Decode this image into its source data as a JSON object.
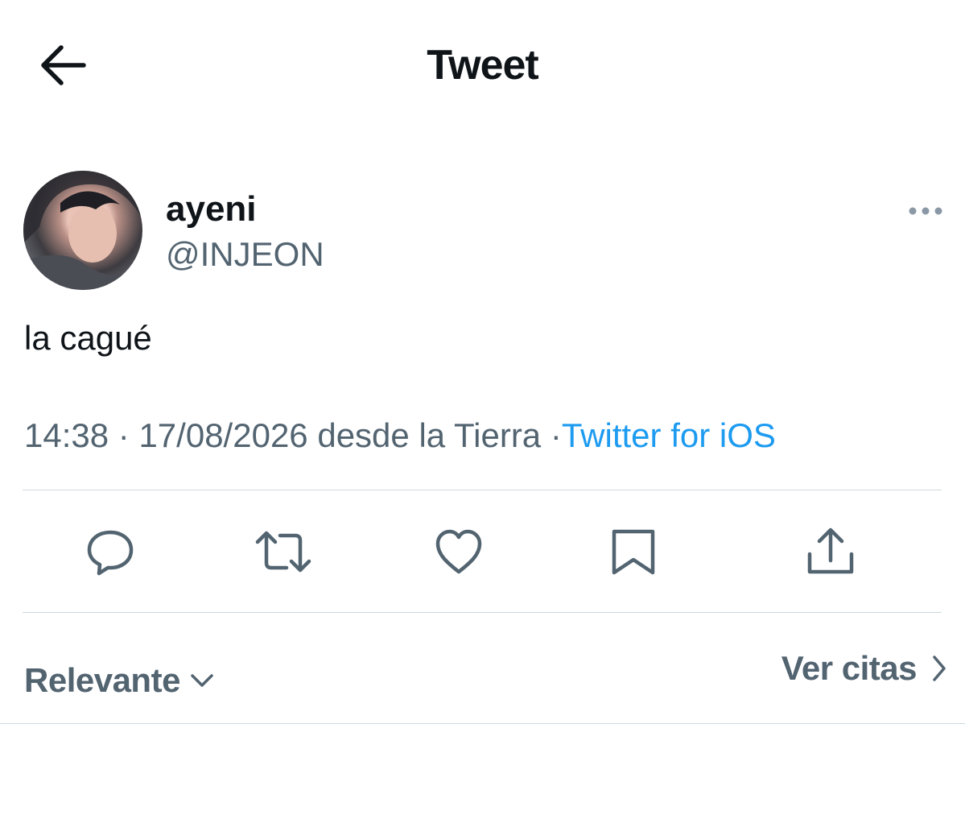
{
  "header": {
    "title": "Tweet",
    "back_icon": "arrow-left-icon"
  },
  "tweet": {
    "author": {
      "display_name": "ayeni",
      "handle": "@INJEON"
    },
    "text": "la cagué",
    "time": "14:38",
    "date": "17/08/2026",
    "location": "desde la Tierra",
    "separator": "·",
    "source": "Twitter for iOS"
  },
  "actions": [
    "reply-icon",
    "retweet-icon",
    "like-icon",
    "bookmark-icon",
    "share-icon"
  ],
  "replies_bar": {
    "filter_label": "Relevante",
    "quotes_label": "Ver citas"
  },
  "colors": {
    "text": "#0f1419",
    "secondary": "#536471",
    "link": "#1d9bf0",
    "divider": "#cfd9de"
  }
}
